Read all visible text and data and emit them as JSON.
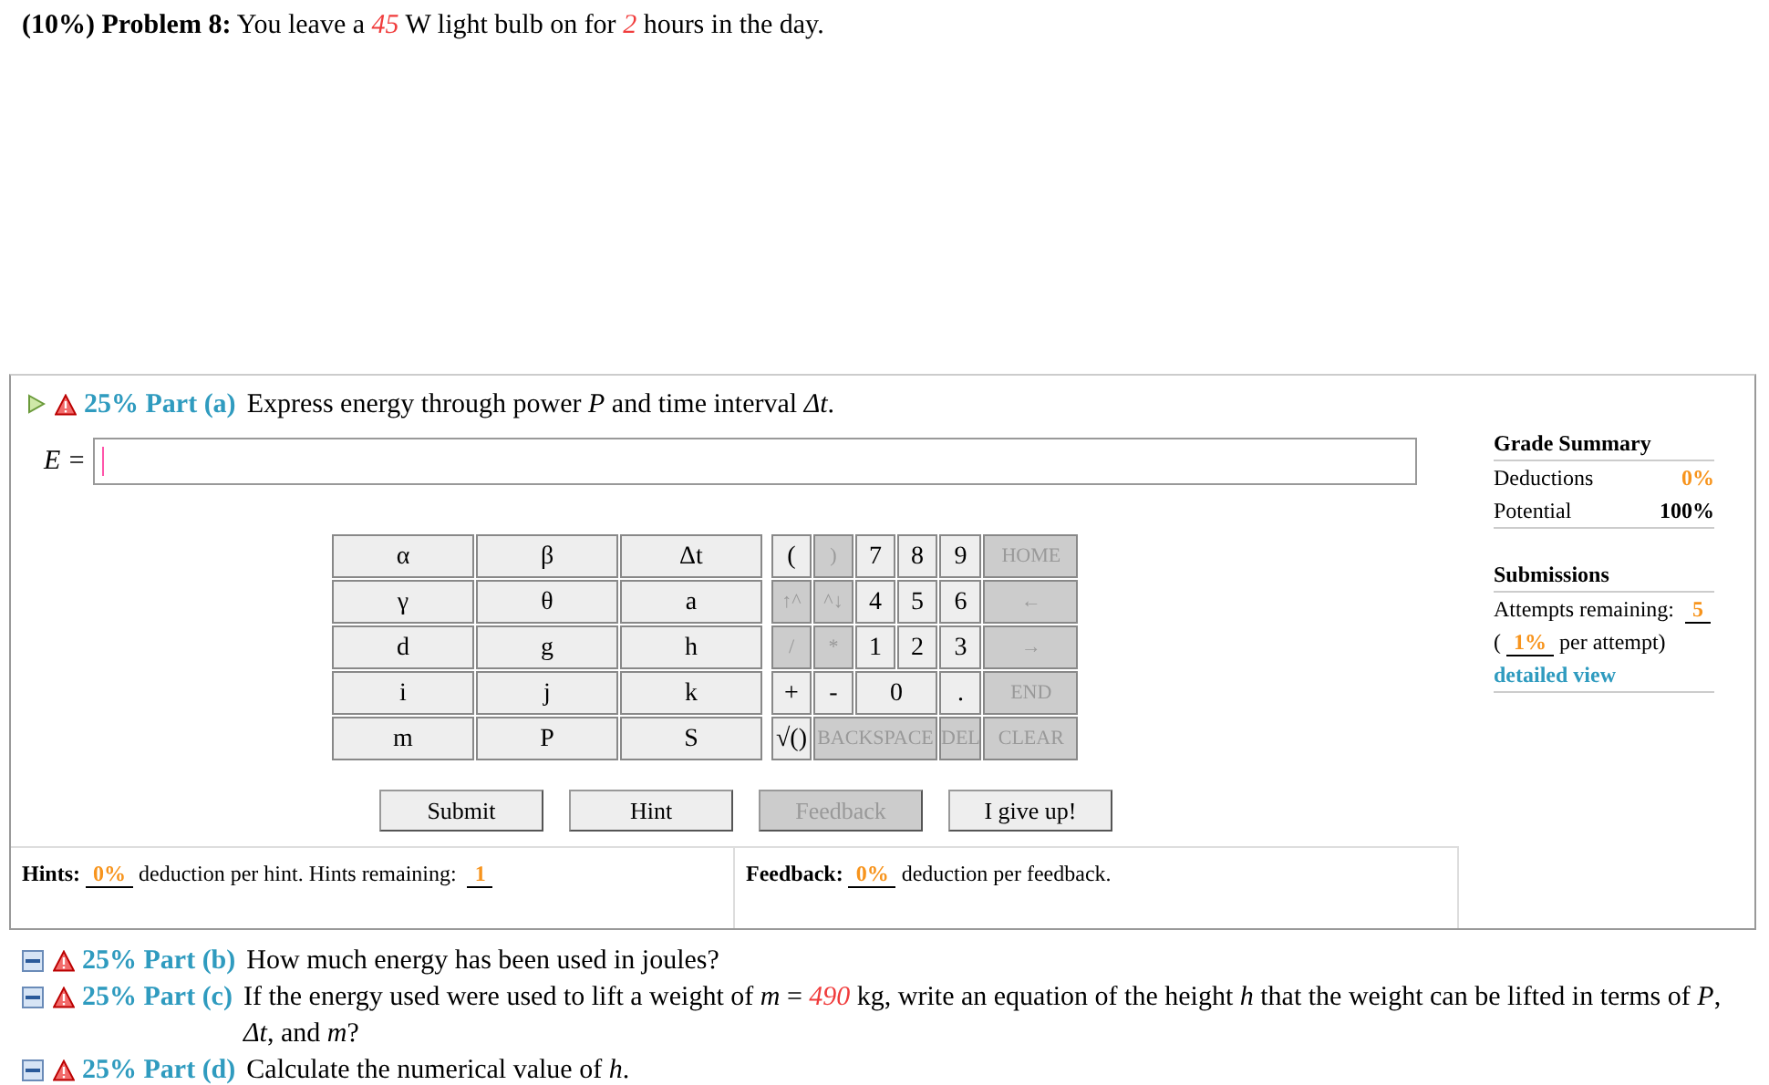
{
  "problem": [
    {
      "text": "(10%) Problem 8:",
      "kind": "bold"
    },
    {
      "text": " You leave a ",
      "kind": "plain"
    },
    {
      "text": "45",
      "kind": "given"
    },
    {
      "text": " W light bulb on for ",
      "kind": "plain"
    },
    {
      "text": "2",
      "kind": "given"
    },
    {
      "text": " hours in the day.",
      "kind": "plain"
    }
  ],
  "active_part": {
    "expanded": true,
    "label": "25% Part (a)",
    "prompt": [
      {
        "text": "Express energy through power ",
        "kind": "plain"
      },
      {
        "text": "P",
        "kind": "var"
      },
      {
        "text": " and time interval ",
        "kind": "plain"
      },
      {
        "text": "Δt",
        "kind": "var"
      },
      {
        "text": ".",
        "kind": "plain"
      }
    ],
    "answer_label": "E =",
    "symbol_keys": [
      [
        "α",
        "β",
        "Δt"
      ],
      [
        "γ",
        "θ",
        "a"
      ],
      [
        "d",
        "g",
        "h"
      ],
      [
        "i",
        "j",
        "k"
      ],
      [
        "m",
        "P",
        "S"
      ]
    ],
    "keypad_rows": [
      [
        {
          "label": "(",
          "disabled": false,
          "kind": "key"
        },
        {
          "label": ")",
          "disabled": true,
          "kind": "key"
        },
        {
          "label": "7",
          "disabled": false,
          "kind": "key"
        },
        {
          "label": "8",
          "disabled": false,
          "kind": "key"
        },
        {
          "label": "9",
          "disabled": false,
          "kind": "key"
        },
        {
          "label": "HOME",
          "disabled": true,
          "kind": "key"
        }
      ],
      [
        {
          "label": "↑^",
          "disabled": true,
          "kind": "key"
        },
        {
          "label": "^↓",
          "disabled": true,
          "kind": "key"
        },
        {
          "label": "4",
          "disabled": false,
          "kind": "key"
        },
        {
          "label": "5",
          "disabled": false,
          "kind": "key"
        },
        {
          "label": "6",
          "disabled": false,
          "kind": "key"
        },
        {
          "label": "←",
          "disabled": true,
          "kind": "key"
        }
      ],
      [
        {
          "label": "/",
          "disabled": true,
          "kind": "key"
        },
        {
          "label": "*",
          "disabled": true,
          "kind": "key"
        },
        {
          "label": "1",
          "disabled": false,
          "kind": "key"
        },
        {
          "label": "2",
          "disabled": false,
          "kind": "key"
        },
        {
          "label": "3",
          "disabled": false,
          "kind": "key"
        },
        {
          "label": "→",
          "disabled": true,
          "kind": "key"
        }
      ],
      [
        {
          "label": "+",
          "disabled": false,
          "kind": "key"
        },
        {
          "label": "-",
          "disabled": false,
          "kind": "key"
        },
        {
          "label": "0",
          "disabled": false,
          "kind": "wide"
        },
        {
          "label": ".",
          "disabled": false,
          "kind": "key"
        },
        {
          "label": "END",
          "disabled": true,
          "kind": "key"
        }
      ],
      [
        {
          "label": "√()",
          "disabled": false,
          "kind": "key"
        },
        {
          "label": "BACKSPACE",
          "disabled": true,
          "kind": "wide"
        },
        {
          "label": "DEL",
          "disabled": true,
          "kind": "key"
        },
        {
          "label": "CLEAR",
          "disabled": true,
          "kind": "key"
        }
      ]
    ],
    "buttons": [
      {
        "label": "Submit",
        "disabled": false
      },
      {
        "label": "Hint",
        "disabled": false
      },
      {
        "label": "Feedback",
        "disabled": true
      },
      {
        "label": "I give up!",
        "disabled": false
      }
    ],
    "hints": [
      {
        "text": "Hints:",
        "kind": "bold"
      },
      {
        "text": "0%",
        "kind": "value"
      },
      {
        "text": " deduction per hint. Hints remaining: ",
        "kind": "plain"
      },
      {
        "text": "1",
        "kind": "value"
      }
    ],
    "feedback": [
      {
        "text": "Feedback:",
        "kind": "bold"
      },
      {
        "text": "0%",
        "kind": "value"
      },
      {
        "text": " deduction per feedback.",
        "kind": "plain"
      }
    ],
    "grade_summary": {
      "title": "Grade Summary",
      "rows": [
        {
          "label": "Deductions",
          "value": "0%",
          "kind": "value"
        },
        {
          "label": "Potential",
          "value": "100%",
          "kind": "bold"
        }
      ]
    },
    "submissions": {
      "title": "Submissions",
      "text": [
        {
          "text": "Attempts remaining: ",
          "kind": "plain"
        },
        {
          "text": "5",
          "kind": "value"
        },
        {
          "text": " (",
          "kind": "plain"
        },
        {
          "text": "1%",
          "kind": "value"
        },
        {
          "text": " per attempt)",
          "kind": "plain"
        }
      ],
      "link": "detailed view"
    }
  },
  "other_parts": [
    {
      "expanded": false,
      "label": "25% Part (b)",
      "prompt": [
        {
          "text": "How much energy has been used in joules?",
          "kind": "plain"
        }
      ]
    },
    {
      "expanded": false,
      "label": "25% Part (c)",
      "prompt": [
        {
          "text": "If the energy used were used to lift a weight of ",
          "kind": "plain"
        },
        {
          "text": "m",
          "kind": "var"
        },
        {
          "text": " = ",
          "kind": "plain"
        },
        {
          "text": "490",
          "kind": "given"
        },
        {
          "text": " kg, write an equation of the height ",
          "kind": "plain"
        },
        {
          "text": "h",
          "kind": "var"
        },
        {
          "text": " that the weight can be lifted in terms of ",
          "kind": "plain"
        },
        {
          "text": "P",
          "kind": "var"
        },
        {
          "text": ", ",
          "kind": "plain"
        },
        {
          "text": "Δt",
          "kind": "var"
        },
        {
          "text": ", and ",
          "kind": "plain"
        },
        {
          "text": "m",
          "kind": "var"
        },
        {
          "text": "?",
          "kind": "plain"
        }
      ]
    },
    {
      "expanded": false,
      "label": "25% Part (d)",
      "prompt": [
        {
          "text": "Calculate the numerical value of ",
          "kind": "plain"
        },
        {
          "text": "h",
          "kind": "var"
        },
        {
          "text": ".",
          "kind": "plain"
        }
      ]
    }
  ]
}
